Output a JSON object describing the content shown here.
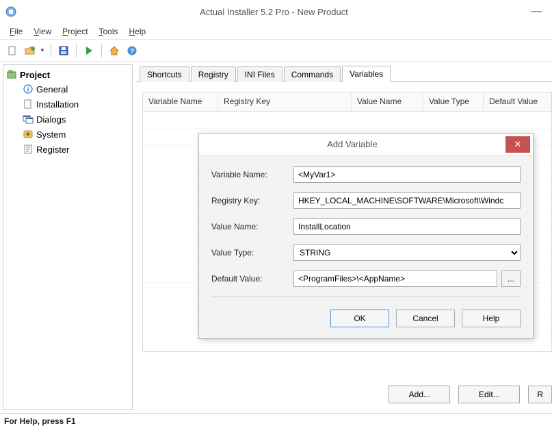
{
  "window": {
    "title": "Actual Installer 5.2 Pro - New Product",
    "minimize": "—"
  },
  "menu": {
    "file": "File",
    "view": "View",
    "project": "Project",
    "tools": "Tools",
    "help": "Help"
  },
  "tree": {
    "root": "Project",
    "items": [
      "General",
      "Installation",
      "Dialogs",
      "System",
      "Register"
    ]
  },
  "tabs": {
    "items": [
      "Shortcuts",
      "Registry",
      "INI Files",
      "Commands",
      "Variables"
    ],
    "active_index": 4
  },
  "grid": {
    "columns": [
      "Variable Name",
      "Registry Key",
      "Value Name",
      "Value Type",
      "Default Value"
    ]
  },
  "buttons": {
    "add": "Add...",
    "edit": "Edit...",
    "remove": "R"
  },
  "statusbar": "For Help, press F1",
  "dialog": {
    "title": "Add Variable",
    "labels": {
      "variable_name": "Variable Name:",
      "registry_key": "Registry Key:",
      "value_name": "Value Name:",
      "value_type": "Value Type:",
      "default_value": "Default Value:"
    },
    "values": {
      "variable_name": "<MyVar1>",
      "registry_key": "HKEY_LOCAL_MACHINE\\SOFTWARE\\Microsoft\\Windc",
      "value_name": "InstallLocation",
      "value_type": "STRING",
      "default_value": "<ProgramFiles>\\<AppName>"
    },
    "browse": "...",
    "buttons": {
      "ok": "OK",
      "cancel": "Cancel",
      "help": "Help"
    }
  }
}
